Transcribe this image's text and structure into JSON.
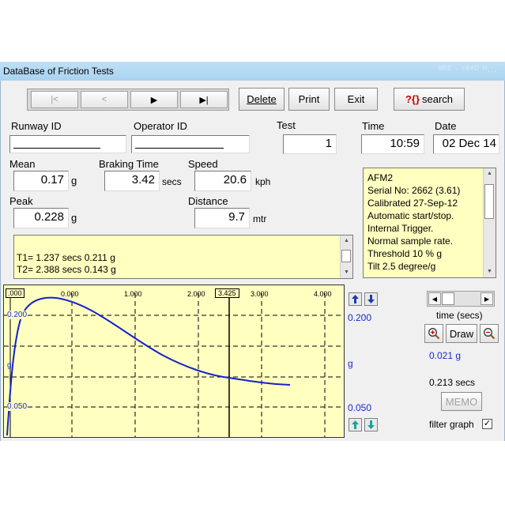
{
  "window": {
    "title": "DataBase of Friction Tests",
    "ghost_title": "ᴹᴱᴱ · ᶜᴮᴬᴰ ᴴ..."
  },
  "toolbar": {
    "nav_first": "|<",
    "nav_prev": "<",
    "nav_next": "▶",
    "nav_last": "▶|",
    "delete_label": "Delete",
    "print_label": "Print",
    "exit_label": "Exit",
    "search_prefix": "?{}",
    "search_label": "search"
  },
  "header": {
    "runway_label": "Runway ID",
    "operator_label": "Operator ID",
    "test_label": "Test",
    "test_value": "1",
    "time_label": "Time",
    "time_value": "10:59",
    "date_label": "Date",
    "date_value": "02 Dec 14"
  },
  "results": {
    "mean_label": "Mean",
    "mean_value": "0.17",
    "mean_unit": "g",
    "braking_label": "Braking Time",
    "braking_value": "3.42",
    "braking_unit": "secs",
    "speed_label": "Speed",
    "speed_value": "20.6",
    "speed_unit": "kph",
    "peak_label": "Peak",
    "peak_value": "0.228",
    "peak_unit": "g",
    "distance_label": "Distance",
    "distance_value": "9.7",
    "distance_unit": "mtr"
  },
  "device_info": {
    "lines": [
      "AFM2",
      "Serial No: 2662  (3.61)",
      "Calibrated 27-Sep-12",
      "Automatic start/stop.",
      "Internal Trigger.",
      "Normal sample rate.",
      "Threshold 10 % g",
      "Tilt 2.5 degree/g"
    ]
  },
  "peaks_memo": {
    "lines": [
      "T1=  1.237 secs  0.211 g",
      "T2=  2.388 secs  0.143 g"
    ]
  },
  "graph": {
    "x_ticks": [
      ".000",
      "0.000",
      "1.000",
      "2.000",
      "3.425",
      "3.000",
      "4.000"
    ],
    "y_left_ticks": [
      "0.200",
      "g",
      "0.050"
    ],
    "right_top": "0.200",
    "right_mid": "g",
    "right_bottom": "0.050",
    "cursor_time": "3.425",
    "curve_color": "#1522c8"
  },
  "side_panel": {
    "time_label": "time (secs)",
    "draw_label": "Draw",
    "g_readout": "0.021 g",
    "secs_readout": "0.213 secs",
    "memo_label": "MEMO",
    "filter_label": "filter graph",
    "filter_checked": "✓"
  }
}
